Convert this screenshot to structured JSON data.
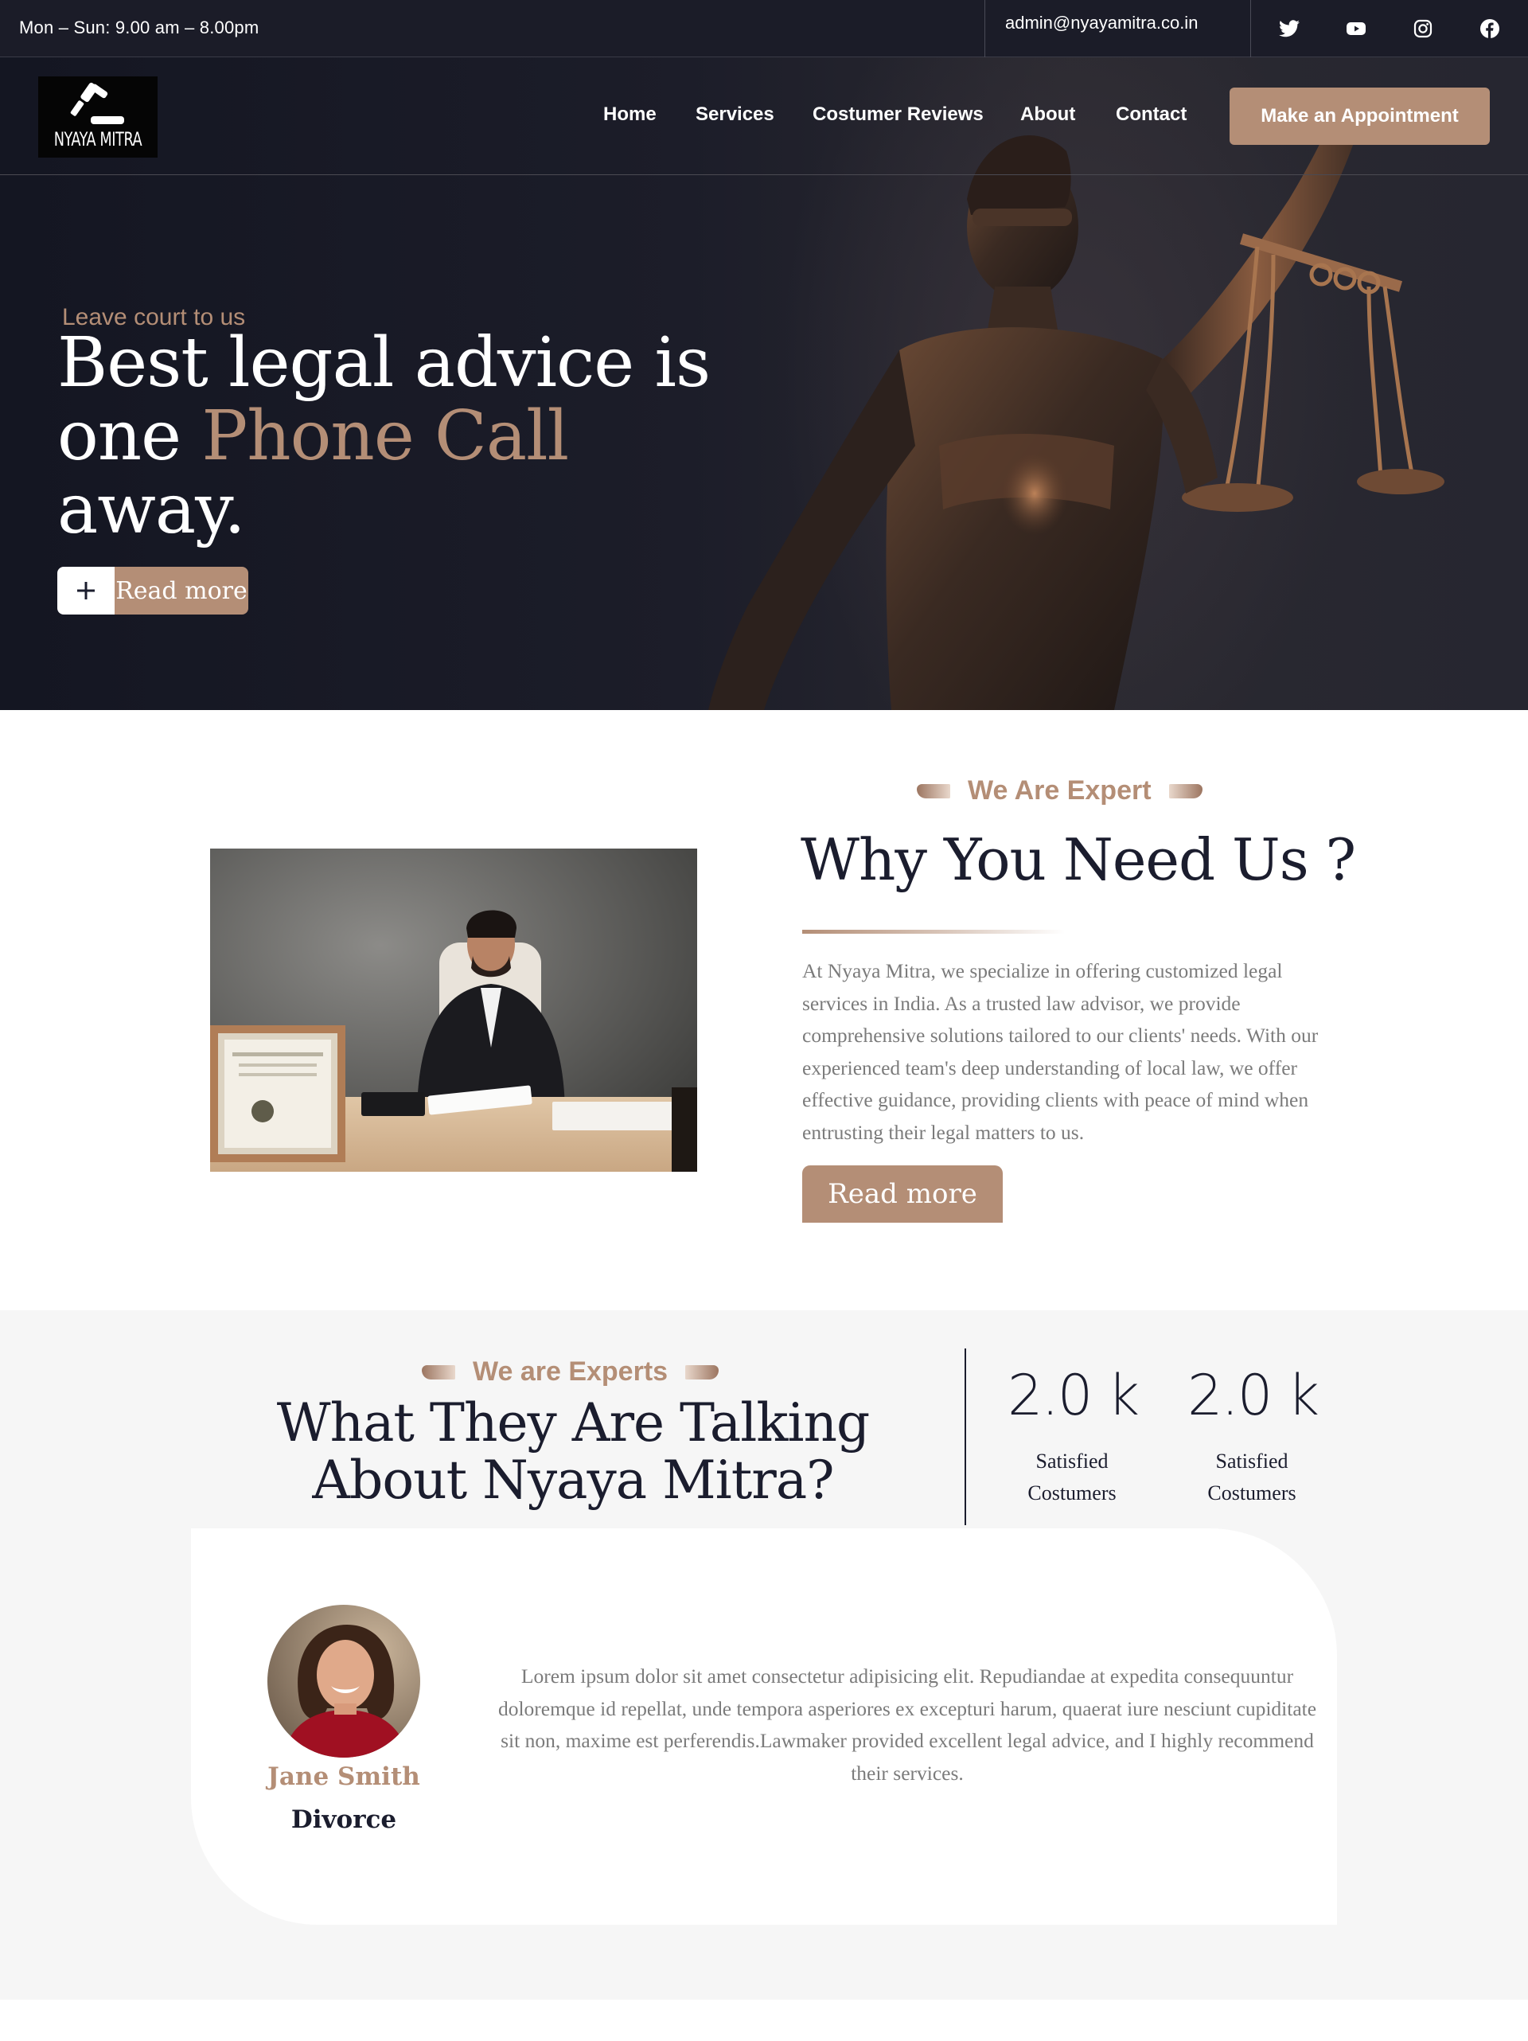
{
  "topbar": {
    "hours": "Mon – Sun: 9.00 am – 8.00pm",
    "email": "admin@nyayamitra.co.in",
    "social_icons": [
      "twitter-icon",
      "youtube-icon",
      "instagram-icon",
      "facebook-icon"
    ]
  },
  "brand": {
    "logo_text": "NYAYA MITRA",
    "accent_color": "#b48e76",
    "dark_color": "#1b1d2e"
  },
  "nav": {
    "items": [
      {
        "label": "Home"
      },
      {
        "label": "Services"
      },
      {
        "label": "Costumer Reviews"
      },
      {
        "label": "About"
      },
      {
        "label": "Contact"
      }
    ],
    "cta_label": "Make an Appointment"
  },
  "hero": {
    "tagline": "Leave court to us",
    "title_part1": "Best legal advice is one ",
    "title_accent": "Phone Call",
    "title_part2": "away.",
    "button_label": "Read more"
  },
  "why": {
    "kicker": "We Are Expert",
    "title": "Why You Need Us ?",
    "body": "At Nyaya Mitra, we specialize in offering customized legal services in India. As a trusted law advisor, we provide comprehensive solutions tailored to our clients' needs. With our experienced team's deep understanding of local law, we offer effective guidance, providing clients with peace of mind when entrusting their legal matters to us.",
    "button_label": "Read more"
  },
  "testimonials": {
    "kicker": "We are Experts",
    "title": "What They Are Talking About Nyaya Mitra?",
    "stats": [
      {
        "value": "2.0 k",
        "label": "Satisfied Costumers"
      },
      {
        "value": "2.0 k",
        "label": "Satisfied Costumers"
      }
    ],
    "review": {
      "name": "Jane Smith",
      "case": "Divorce",
      "quote": "Lorem ipsum dolor sit amet consectetur adipisicing elit. Repudiandae at expedita consequuntur doloremque id repellat, unde tempora asperiores ex excepturi harum, quaerat iure nesciunt cupiditate sit non, maxime est perferendis.Lawmaker provided excellent legal advice, and I highly recommend their services."
    }
  }
}
